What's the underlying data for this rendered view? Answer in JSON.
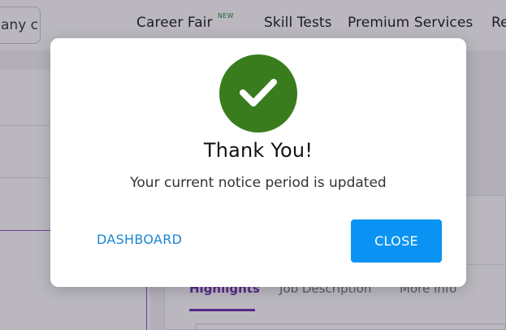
{
  "header": {
    "search_text": "any c",
    "nav": [
      {
        "label": "Career Fair",
        "badge": "NEW"
      },
      {
        "label": "Skill Tests"
      },
      {
        "label": "Premium Services"
      },
      {
        "label": "Re"
      }
    ]
  },
  "job": {
    "tabs": [
      {
        "label": "Highlights",
        "active": true
      },
      {
        "label": "Job Description",
        "active": false
      },
      {
        "label": "More Info",
        "active": false
      }
    ]
  },
  "modal": {
    "icon": "checkmark-icon",
    "icon_color": "#397c1e",
    "title": "Thank You!",
    "message": "Your current notice period is updated",
    "dashboard_label": "DASHBOARD",
    "close_label": "CLOSE",
    "accent": "#0a93f3"
  }
}
